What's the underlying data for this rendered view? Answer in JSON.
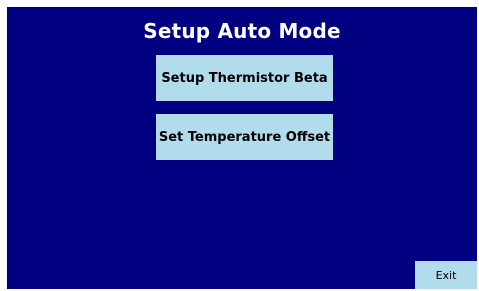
{
  "screen": {
    "title": "Setup Auto Mode",
    "colors": {
      "background": "#000080",
      "button": "#b0dcec",
      "title_text": "#ffffff",
      "button_text": "#000000"
    }
  },
  "buttons": {
    "setup_thermistor_beta": "Setup Thermistor Beta",
    "set_temperature_offset": "Set Temperature Offset",
    "exit": "Exit"
  }
}
